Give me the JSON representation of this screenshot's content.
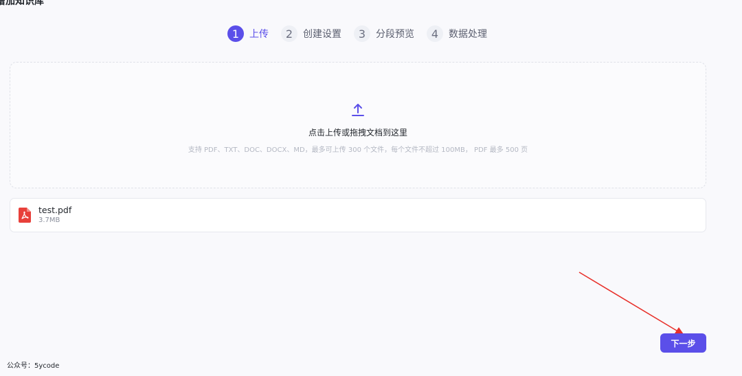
{
  "page": {
    "heading": "增加知识库"
  },
  "steps": [
    {
      "num": "1",
      "label": "上传",
      "active": true
    },
    {
      "num": "2",
      "label": "创建设置",
      "active": false
    },
    {
      "num": "3",
      "label": "分段预览",
      "active": false
    },
    {
      "num": "4",
      "label": "数据处理",
      "active": false
    }
  ],
  "dropzone": {
    "icon": "upload-icon",
    "title": "点击上传或拖拽文档到这里",
    "hint": "支持 PDF、TXT、DOC、DOCX、MD，最多可上传 300 个文件，每个文件不超过 100MB， PDF 最多 500 页"
  },
  "files": [
    {
      "name": "test.pdf",
      "size": "3.7MB",
      "icon": "pdf-file-icon",
      "icon_color": "#e8403a"
    }
  ],
  "actions": {
    "next_label": "下一步"
  },
  "annotation": {
    "arrow_color": "#e8302a"
  },
  "watermark": "公众号：5ycode",
  "colors": {
    "accent": "#5b4fe9"
  }
}
